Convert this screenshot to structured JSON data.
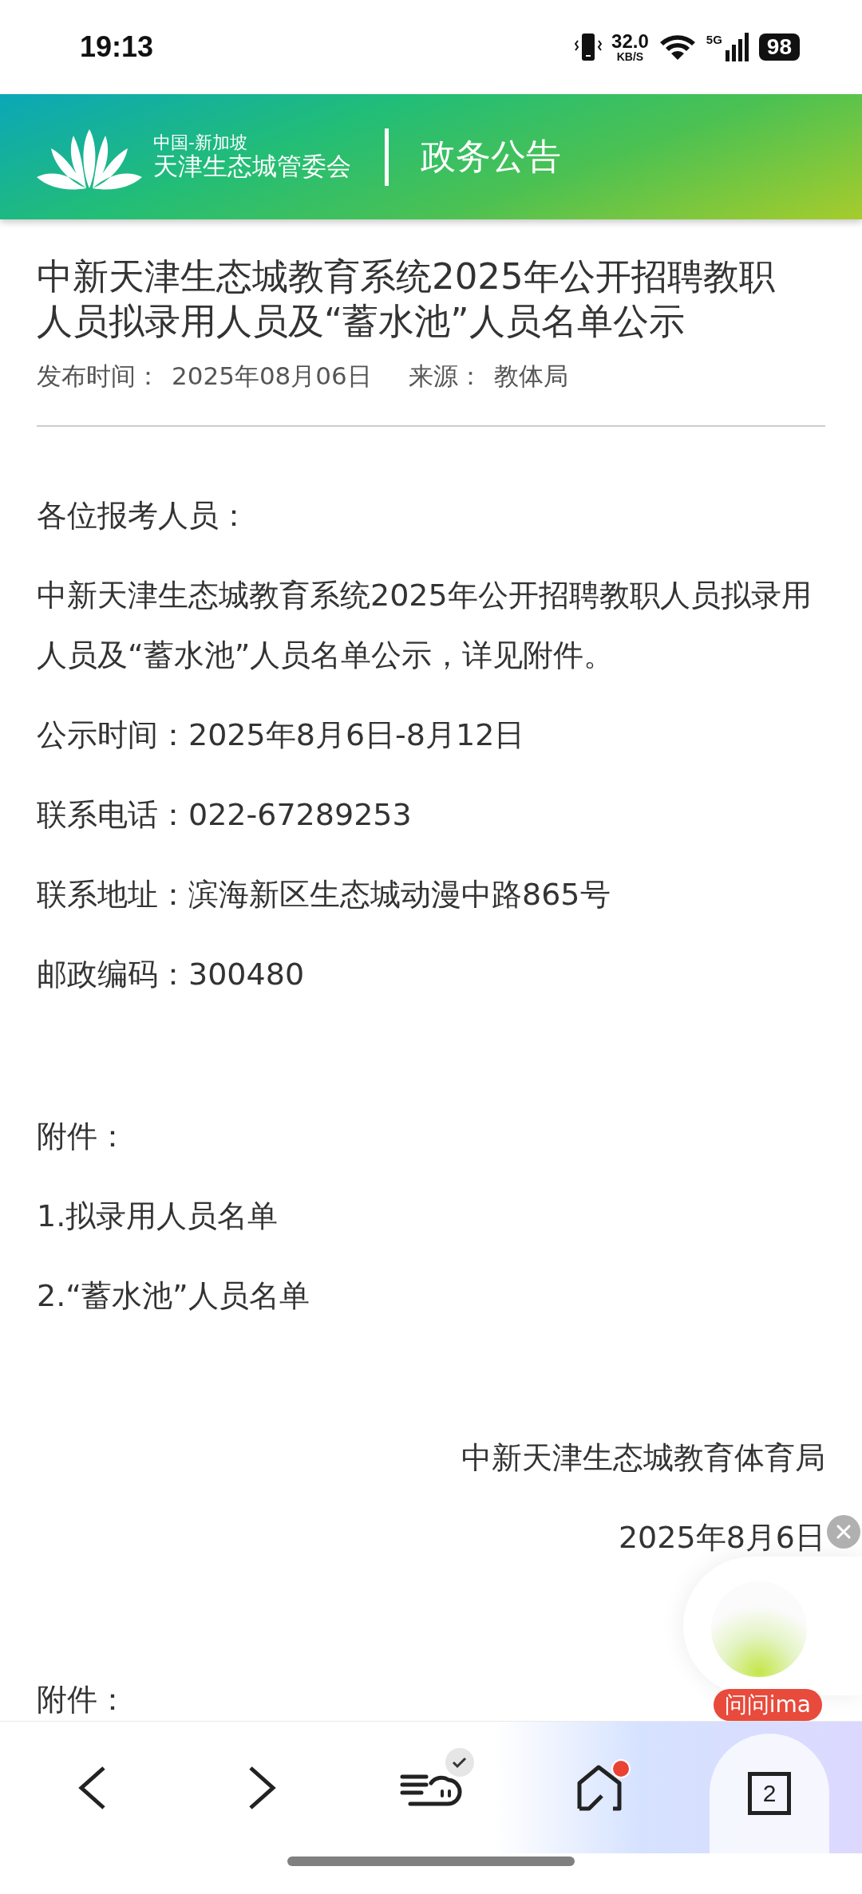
{
  "status_bar": {
    "time": "19:13",
    "speed": "32.0",
    "speed_unit": "KB/S",
    "network": "5G",
    "battery": "98"
  },
  "header": {
    "org_top": "中国-新加坡",
    "org_name": "天津生态城管委会",
    "section": "政务公告"
  },
  "article": {
    "title": "中新天津生态城教育系统2025年公开招聘教职人员拟录用人员及“蓄水池”人员名单公示",
    "meta": [
      {
        "label": "发布时间：",
        "value": "2025年08月06日"
      },
      {
        "label": "来源：",
        "value": "教体局"
      }
    ],
    "sections": [
      {
        "kind": "text",
        "lines": [
          "各位报考人员：",
          "中新天津生态城教育系统2025年公开招聘教职人员拟录用人员及“蓄水池”人员名单公示，详见附件。",
          "公示时间：2025年8月6日-8月12日",
          "联系电话：022-67289253",
          "联系地址：滨海新区生态城动漫中路865号",
          "邮政编码：300480"
        ]
      },
      {
        "kind": "text",
        "lines": [
          "附件：",
          "1.拟录用人员名单",
          "2.“蓄水池”人员名单"
        ]
      },
      {
        "kind": "signature",
        "lines": [
          "中新天津生态城教育体育局",
          "2025年8月6日"
        ]
      },
      {
        "kind": "text",
        "lines": [
          "附件："
        ]
      }
    ]
  },
  "assistant": {
    "badge": "问问ima"
  },
  "nav": [
    {
      "kind": "back"
    },
    {
      "kind": "forward"
    },
    {
      "kind": "cloud",
      "checked": true
    },
    {
      "kind": "home",
      "notification": true
    },
    {
      "kind": "tabs",
      "count": "2"
    }
  ]
}
